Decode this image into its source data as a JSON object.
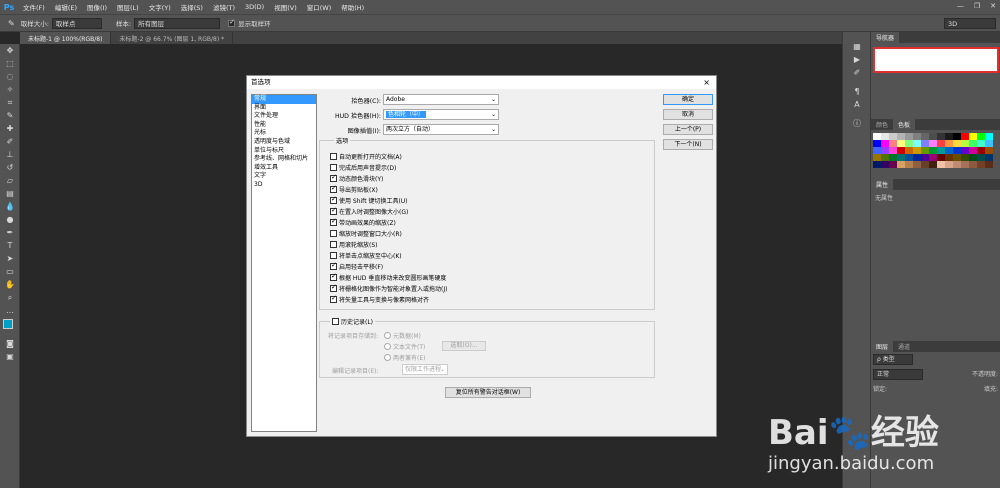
{
  "app": {
    "logo": "Ps"
  },
  "menubar": {
    "items": [
      "文件(F)",
      "编辑(E)",
      "图像(I)",
      "图层(L)",
      "文字(Y)",
      "选择(S)",
      "滤镜(T)",
      "3D(D)",
      "视图(V)",
      "窗口(W)",
      "帮助(H)"
    ]
  },
  "optbar": {
    "sample_size_label": "取样大小:",
    "sample_size_value": "取样点",
    "sample_label": "样本:",
    "sample_value": "所有图层",
    "show_ring_label": "显示取样环",
    "workspace": "3D"
  },
  "tabs": [
    {
      "label": "未标题-1 @ 100%(RGB/8)"
    },
    {
      "label": "未标题-2 @ 66.7% (图层 1, RGB/8) *"
    }
  ],
  "right_panel": {
    "navigator_tab": "导航器",
    "swatch_tabs": [
      "颜色",
      "色板"
    ],
    "properties_tab": "属性",
    "properties_text": "无属性",
    "layers_tabs": [
      "图层",
      "通道"
    ],
    "layers_kind": "ρ 类型",
    "layers_blend": "正常",
    "layers_opacity_label": "不透明度:",
    "layers_lock_label": "锁定:",
    "layers_fill_label": "填充:"
  },
  "swatch_colors": [
    "#ffffff",
    "#e6e6e6",
    "#cccccc",
    "#b3b3b3",
    "#999999",
    "#808080",
    "#666666",
    "#4d4d4d",
    "#333333",
    "#1a1a1a",
    "#000000",
    "#ff0000",
    "#ffff00",
    "#00ff00",
    "#00ffff",
    "#0000ff",
    "#ff00ff",
    "#ff8080",
    "#ffff80",
    "#80ff80",
    "#80ffff",
    "#8080ff",
    "#ff80ff",
    "#ff4040",
    "#ff9940",
    "#ffd940",
    "#b3ff40",
    "#40ff66",
    "#40ffcc",
    "#40bfff",
    "#4066ff",
    "#9940ff",
    "#ff40d9",
    "#cc0000",
    "#cc6600",
    "#cc9900",
    "#669900",
    "#009933",
    "#009999",
    "#0066cc",
    "#0033cc",
    "#6600cc",
    "#cc0099",
    "#990000",
    "#994c00",
    "#997300",
    "#4d7300",
    "#00732a",
    "#007373",
    "#004d99",
    "#002699",
    "#4d0099",
    "#990073",
    "#660000",
    "#663300",
    "#664d00",
    "#334d00",
    "#004d1a",
    "#004d4d",
    "#003366",
    "#001a66",
    "#330066",
    "#66004d",
    "#d9a066",
    "#b38050",
    "#8c6040",
    "#664028",
    "#402010",
    "#f2c2a6",
    "#d9a68c",
    "#bf8c73",
    "#a6735a",
    "#8c5a40",
    "#734026",
    "#592d1a"
  ],
  "dialog": {
    "title": "首选项",
    "close": "×",
    "categories": [
      "常规",
      "界面",
      "文件处理",
      "性能",
      "光标",
      "透明度与色域",
      "单位与标尺",
      "参考线、网格和切片",
      "增效工具",
      "文字",
      "3D"
    ],
    "color_picker_label": "拾色器(C):",
    "color_picker_value": "Adobe",
    "hud_picker_label": "HUD 拾色器(H):",
    "hud_picker_value": "色相轮（中）",
    "interp_label": "图像插值(I):",
    "interp_value": "两次立方（自动）",
    "options_legend": "选项",
    "options": [
      {
        "label": "自动更新打开的文档(A)",
        "checked": false
      },
      {
        "label": "完成后用声音提示(D)",
        "checked": false
      },
      {
        "label": "动态颜色滑块(Y)",
        "checked": true
      },
      {
        "label": "导出剪贴板(X)",
        "checked": true
      },
      {
        "label": "使用 Shift 键切换工具(U)",
        "checked": true
      },
      {
        "label": "在置入时调整图像大小(G)",
        "checked": true
      },
      {
        "label": "带动画效果的缩放(Z)",
        "checked": true
      },
      {
        "label": "缩放时调整窗口大小(R)",
        "checked": false
      },
      {
        "label": "用滚轮缩放(S)",
        "checked": false
      },
      {
        "label": "将单击点缩放至中心(K)",
        "checked": false
      },
      {
        "label": "启用轻击平移(F)",
        "checked": true
      },
      {
        "label": "根据 HUD 垂直移动来改变圆形画笔硬度",
        "checked": true
      },
      {
        "label": "将栅格化图像作为智能对象置入或拖动(J)",
        "checked": true
      },
      {
        "label": "将矢量工具与变换与像素网格对齐",
        "checked": true
      }
    ],
    "history_label": "历史记录(L)",
    "history_save_to": "将记录项目存储到:",
    "history_radio_1": "元数据(M)",
    "history_radio_2": "文本文件(T)",
    "history_radio_3": "两者兼有(E)",
    "history_choose": "选取(O)...",
    "history_edit_label": "编辑记录项目(E):",
    "history_edit_value": "仅限工作进程",
    "reset_warnings": "复位所有警告对话框(W)",
    "buttons": {
      "ok": "确定",
      "cancel": "取消",
      "prev": "上一个(P)",
      "next": "下一个(N)"
    }
  },
  "watermark": {
    "brand": "Bai",
    "brand2": "经验",
    "url": "jingyan.baidu.com"
  }
}
